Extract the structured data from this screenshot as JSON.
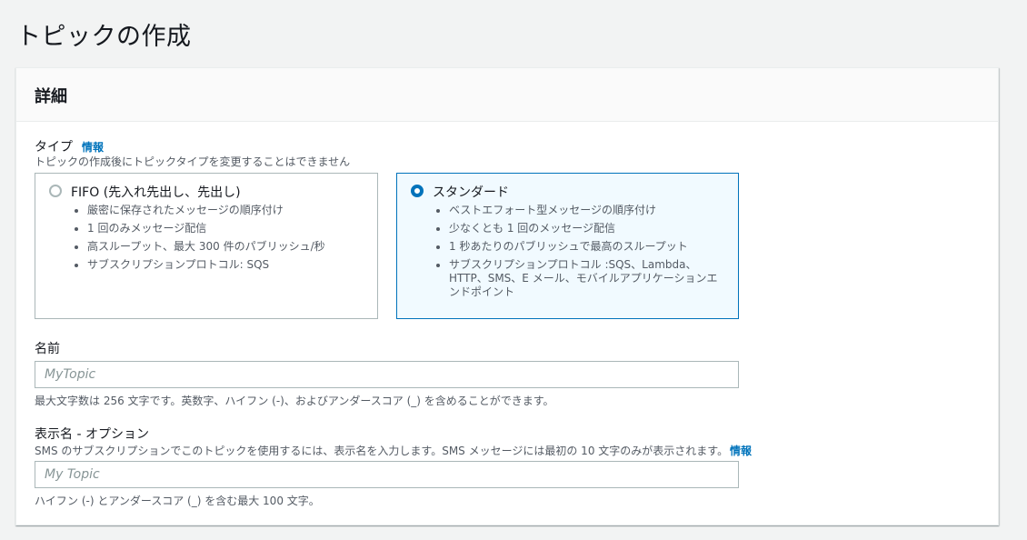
{
  "page_title": "トピックの作成",
  "details": {
    "header": "詳細",
    "type": {
      "label": "タイプ",
      "info": "情報",
      "description": "トピックの作成後にトピックタイプを変更することはできません",
      "options": [
        {
          "title": "FIFO (先入れ先出し、先出し)",
          "selected": false,
          "bullets": [
            "厳密に保存されたメッセージの順序付け",
            "1 回のみメッセージ配信",
            "高スループット、最大 300 件のパブリッシュ/秒",
            "サブスクリプションプロトコル: SQS"
          ]
        },
        {
          "title": "スタンダード",
          "selected": true,
          "bullets": [
            "ベストエフォート型メッセージの順序付け",
            "少なくとも 1 回のメッセージ配信",
            "1 秒あたりのパブリッシュで最高のスループット",
            "サブスクリプションプロトコル :SQS、Lambda、HTTP、SMS、E メール、モバイルアプリケーションエンドポイント"
          ]
        }
      ]
    },
    "name": {
      "label": "名前",
      "placeholder": "MyTopic",
      "value": "",
      "constraint": "最大文字数は 256 文字です。英数字、ハイフン (-)、およびアンダースコア (_) を含めることができます。"
    },
    "display_name": {
      "label": "表示名 - オプション",
      "description": "SMS のサブスクリプションでこのトピックを使用するには、表示名を入力します。SMS メッセージには最初の 10 文字のみが表示されます。",
      "info": "情報",
      "placeholder": "My Topic",
      "value": "",
      "constraint": "ハイフン (-) とアンダースコア (_) を含む最大 100 文字。"
    }
  },
  "colors": {
    "accent": "#0073bb",
    "selected_bg": "#f1faff",
    "border": "#aab7b8",
    "secondary_text": "#545b64"
  }
}
